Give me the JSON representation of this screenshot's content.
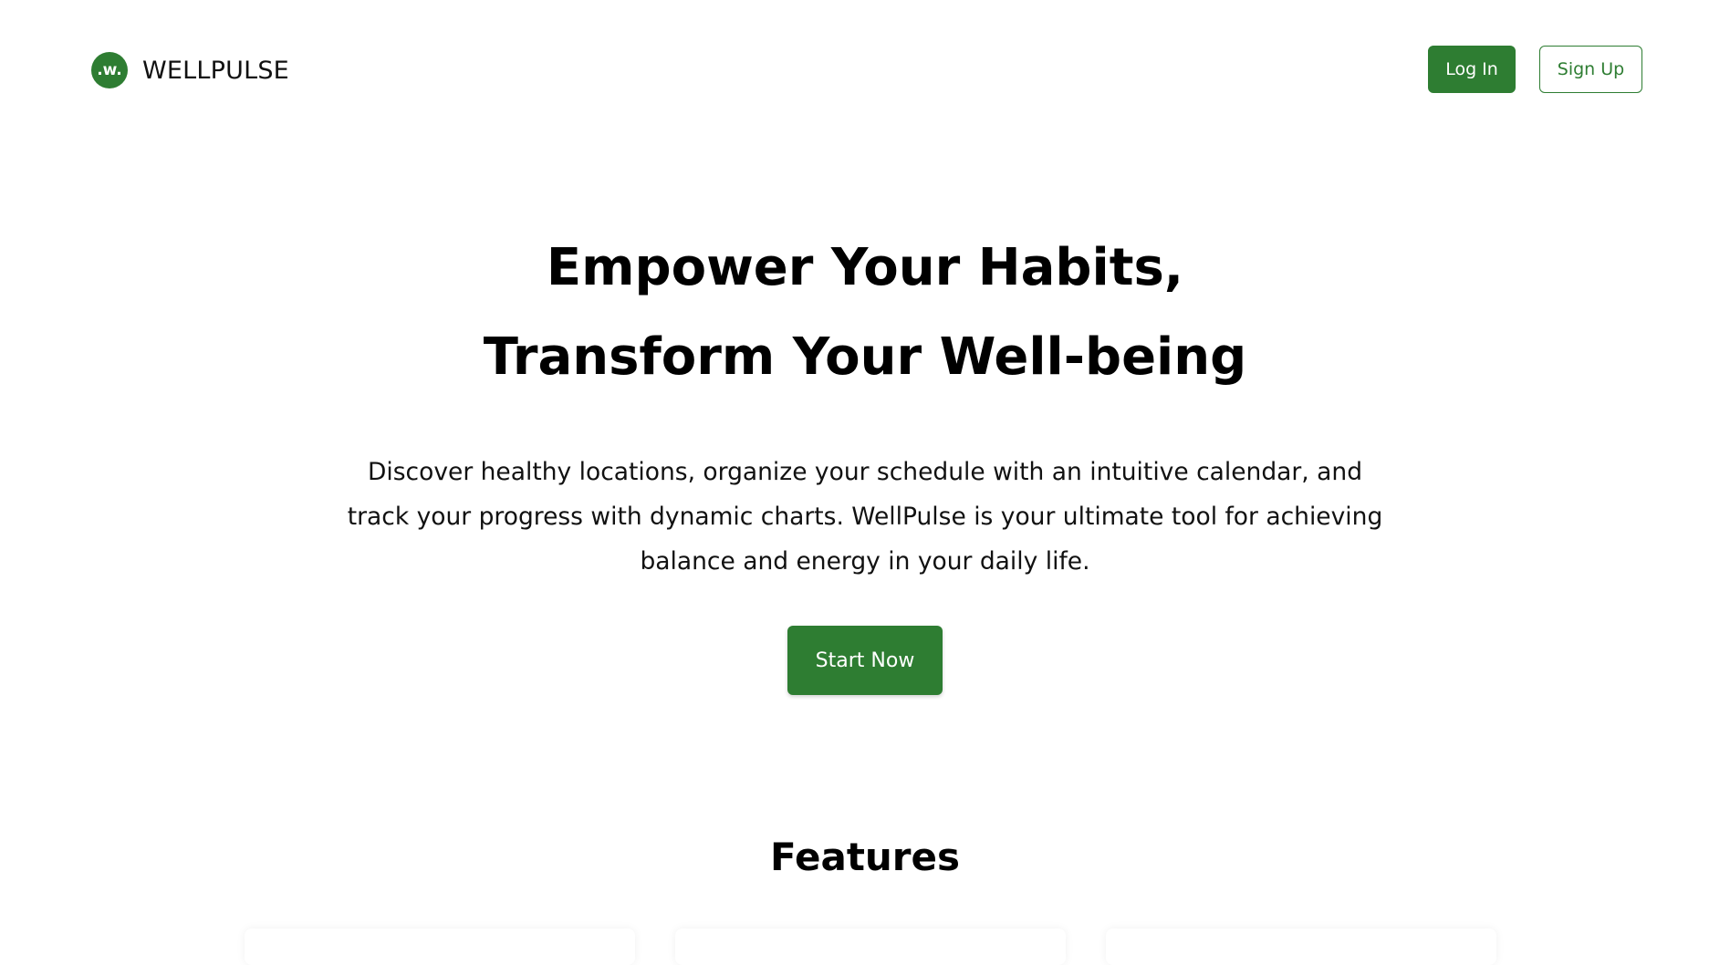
{
  "brand": {
    "logo_glyph": ".w.",
    "name": "WELLPULSE",
    "accent_color": "#2e7d32"
  },
  "nav": {
    "login_label": "Log In",
    "signup_label": "Sign Up"
  },
  "hero": {
    "title_line1": "Empower Your Habits,",
    "title_line2": "Transform Your Well-being",
    "description": "Discover healthy locations, organize your schedule with an intuitive calendar, and track your progress with dynamic charts. WellPulse is your ultimate tool for achieving balance and energy in your daily life.",
    "cta_label": "Start Now"
  },
  "features": {
    "heading": "Features"
  }
}
